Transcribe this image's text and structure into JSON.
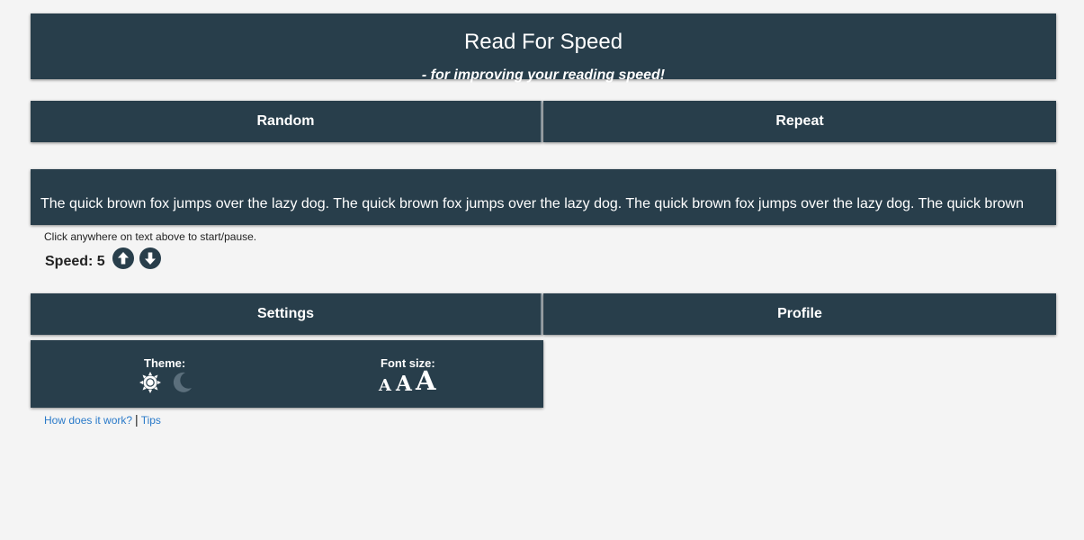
{
  "header": {
    "title": "Read For Speed",
    "subtitle": "- for improving your reading speed!"
  },
  "modes": {
    "random_label": "Random",
    "repeat_label": "Repeat"
  },
  "reader": {
    "text": "The quick brown fox jumps over the lazy dog. The quick brown fox jumps over the lazy dog. The quick brown fox jumps over the lazy dog. The quick brown",
    "hint": "Click anywhere on text above to start/pause.",
    "speed_label": "Speed: 5",
    "speed_up_icon": "arrow-up-circle-icon",
    "speed_down_icon": "arrow-down-circle-icon"
  },
  "tabs": {
    "settings_label": "Settings",
    "profile_label": "Profile"
  },
  "settings": {
    "theme_label": "Theme:",
    "theme_options": [
      "sun-icon",
      "moon-icon"
    ],
    "font_size_label": "Font size:",
    "font_size_options": [
      "A",
      "A",
      "A"
    ]
  },
  "footer": {
    "how_link": "How does it work?",
    "separator": "|",
    "tips_link": "Tips"
  },
  "colors": {
    "panel": "#283e4b",
    "background": "#f4f4f4",
    "link": "#2a7ac9"
  }
}
